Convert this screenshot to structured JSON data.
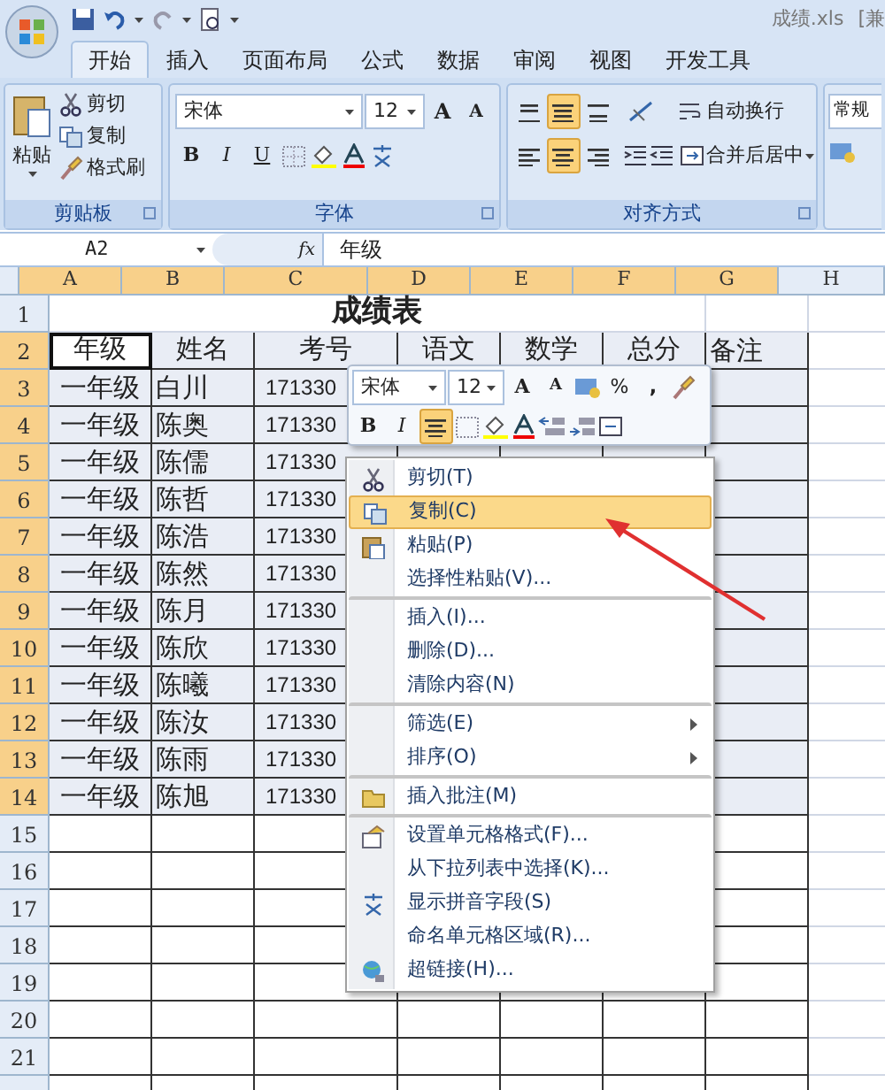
{
  "title_bar": {
    "file_title": "成绩.xls",
    "extra": "[兼"
  },
  "tabs": [
    {
      "label": "开始",
      "selected": true
    },
    {
      "label": "插入",
      "selected": false
    },
    {
      "label": "页面布局",
      "selected": false
    },
    {
      "label": "公式",
      "selected": false
    },
    {
      "label": "数据",
      "selected": false
    },
    {
      "label": "审阅",
      "selected": false
    },
    {
      "label": "视图",
      "selected": false
    },
    {
      "label": "开发工具",
      "selected": false
    }
  ],
  "ribbon": {
    "clipboard": {
      "label": "剪贴板",
      "paste": "粘贴",
      "items": [
        "剪切",
        "复制",
        "格式刷"
      ]
    },
    "font": {
      "label": "字体",
      "font_name": "宋体",
      "font_size": "12",
      "grow": "A",
      "shrink": "A",
      "bold": "B",
      "italic": "I",
      "underline": "U"
    },
    "alignment": {
      "label": "对齐方式",
      "vertical": [
        {
          "selected": false
        },
        {
          "selected": true
        },
        {
          "selected": false
        }
      ],
      "horizontal": [
        {
          "selected": false
        },
        {
          "selected": true
        },
        {
          "selected": false
        }
      ],
      "wrap": "自动换行",
      "merge": "合并后居中"
    },
    "number": {
      "format": "常规"
    }
  },
  "formula_bar": {
    "name_box": "A2",
    "fx": "fx",
    "formula": "年级"
  },
  "columns": [
    {
      "label": "A",
      "selected": true
    },
    {
      "label": "B",
      "selected": true
    },
    {
      "label": "C",
      "selected": true
    },
    {
      "label": "D",
      "selected": true
    },
    {
      "label": "E",
      "selected": true
    },
    {
      "label": "F",
      "selected": true
    },
    {
      "label": "G",
      "selected": true
    },
    {
      "label": "H",
      "selected": false
    }
  ],
  "title_row": {
    "number": "1",
    "selected": false,
    "title": "成绩表"
  },
  "rows": [
    {
      "number": "2",
      "selected": true,
      "cells": [
        {
          "text": "年级",
          "active": true
        },
        {
          "text": "姓名",
          "active": false
        },
        {
          "text": "考号",
          "active": false
        },
        {
          "text": "语文",
          "active": false
        },
        {
          "text": "数学",
          "active": false
        },
        {
          "text": "总分",
          "active": false
        },
        {
          "text": "备注",
          "active": false
        }
      ]
    },
    {
      "number": "3",
      "selected": true,
      "cells": [
        {
          "text": "一年级",
          "active": false
        },
        {
          "text": "白川",
          "active": false
        },
        {
          "text": "171330",
          "active": false
        }
      ]
    },
    {
      "number": "4",
      "selected": true,
      "cells": [
        {
          "text": "一年级",
          "active": false
        },
        {
          "text": "陈奥",
          "active": false
        },
        {
          "text": "171330",
          "active": false
        }
      ]
    },
    {
      "number": "5",
      "selected": true,
      "cells": [
        {
          "text": "一年级",
          "active": false
        },
        {
          "text": "陈儒",
          "active": false
        },
        {
          "text": "171330",
          "active": false
        }
      ]
    },
    {
      "number": "6",
      "selected": true,
      "cells": [
        {
          "text": "一年级",
          "active": false
        },
        {
          "text": "陈哲",
          "active": false
        },
        {
          "text": "171330",
          "active": false
        }
      ]
    },
    {
      "number": "7",
      "selected": true,
      "cells": [
        {
          "text": "一年级",
          "active": false
        },
        {
          "text": "陈浩",
          "active": false
        },
        {
          "text": "171330",
          "active": false
        }
      ]
    },
    {
      "number": "8",
      "selected": true,
      "cells": [
        {
          "text": "一年级",
          "active": false
        },
        {
          "text": "陈然",
          "active": false
        },
        {
          "text": "171330",
          "active": false
        }
      ]
    },
    {
      "number": "9",
      "selected": true,
      "cells": [
        {
          "text": "一年级",
          "active": false
        },
        {
          "text": "陈月",
          "active": false
        },
        {
          "text": "171330",
          "active": false
        }
      ]
    },
    {
      "number": "10",
      "selected": true,
      "cells": [
        {
          "text": "一年级",
          "active": false
        },
        {
          "text": "陈欣",
          "active": false
        },
        {
          "text": "171330",
          "active": false
        }
      ]
    },
    {
      "number": "11",
      "selected": true,
      "cells": [
        {
          "text": "一年级",
          "active": false
        },
        {
          "text": "陈曦",
          "active": false
        },
        {
          "text": "171330",
          "active": false
        }
      ]
    },
    {
      "number": "12",
      "selected": true,
      "cells": [
        {
          "text": "一年级",
          "active": false
        },
        {
          "text": "陈汝",
          "active": false
        },
        {
          "text": "171330",
          "active": false
        }
      ]
    },
    {
      "number": "13",
      "selected": true,
      "cells": [
        {
          "text": "一年级",
          "active": false
        },
        {
          "text": "陈雨",
          "active": false
        },
        {
          "text": "171330",
          "active": false
        }
      ]
    },
    {
      "number": "14",
      "selected": true,
      "cells": [
        {
          "text": "一年级",
          "active": false
        },
        {
          "text": "陈旭",
          "active": false
        },
        {
          "text": "171330",
          "active": false
        }
      ]
    },
    {
      "number": "15",
      "selected": false
    },
    {
      "number": "16",
      "selected": false
    },
    {
      "number": "17",
      "selected": false
    },
    {
      "number": "18",
      "selected": false
    },
    {
      "number": "19",
      "selected": false
    },
    {
      "number": "20",
      "selected": false
    },
    {
      "number": "21",
      "selected": false
    }
  ],
  "mini_toolbar": {
    "font_name": "宋体",
    "font_size": "12",
    "grow": "A",
    "shrink": "A",
    "percent": "%",
    "comma": ",",
    "bold": "B",
    "italic": "I",
    "center_selected": true
  },
  "context_menu": [
    {
      "label": "剪切(T)",
      "selected": false,
      "separator_before": false,
      "submenu": false
    },
    {
      "label": "复制(C)",
      "selected": true,
      "separator_before": false,
      "submenu": false
    },
    {
      "label": "粘贴(P)",
      "selected": false,
      "separator_before": false,
      "submenu": false
    },
    {
      "label": "选择性粘贴(V)...",
      "selected": false,
      "separator_before": false,
      "submenu": false
    },
    {
      "label": "插入(I)...",
      "selected": false,
      "separator_before": true,
      "submenu": false
    },
    {
      "label": "删除(D)...",
      "selected": false,
      "separator_before": false,
      "submenu": false
    },
    {
      "label": "清除内容(N)",
      "selected": false,
      "separator_before": false,
      "submenu": false
    },
    {
      "label": "筛选(E)",
      "selected": false,
      "separator_before": true,
      "submenu": true
    },
    {
      "label": "排序(O)",
      "selected": false,
      "separator_before": false,
      "submenu": true
    },
    {
      "label": "插入批注(M)",
      "selected": false,
      "separator_before": true,
      "submenu": false
    },
    {
      "label": "设置单元格格式(F)...",
      "selected": false,
      "separator_before": true,
      "submenu": false
    },
    {
      "label": "从下拉列表中选择(K)...",
      "selected": false,
      "separator_before": false,
      "submenu": false
    },
    {
      "label": "显示拼音字段(S)",
      "selected": false,
      "separator_before": false,
      "submenu": false
    },
    {
      "label": "命名单元格区域(R)...",
      "selected": false,
      "separator_before": false,
      "submenu": false
    },
    {
      "label": "超链接(H)...",
      "selected": false,
      "separator_before": false,
      "submenu": false
    }
  ]
}
